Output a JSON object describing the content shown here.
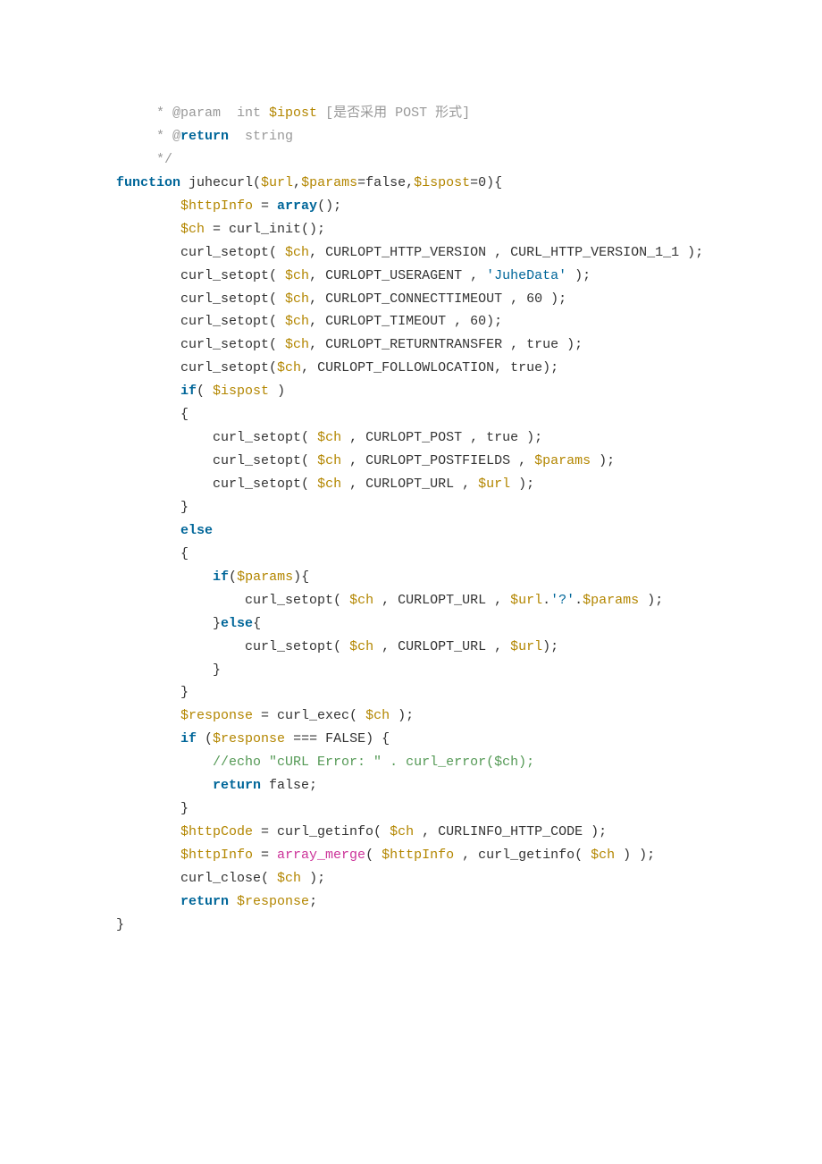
{
  "lines": [
    {
      "indent": 1,
      "segments": [
        {
          "cls": "comment",
          "t": " * @param  int "
        },
        {
          "cls": "variable",
          "t": "$ipost"
        },
        {
          "cls": "comment",
          "t": " [是否采用 POST 形式]"
        }
      ]
    },
    {
      "indent": 1,
      "segments": [
        {
          "cls": "comment",
          "t": " * @"
        },
        {
          "cls": "keyword",
          "t": "return"
        },
        {
          "cls": "comment",
          "t": "  string"
        }
      ]
    },
    {
      "indent": 1,
      "segments": [
        {
          "cls": "comment",
          "t": " */"
        }
      ]
    },
    {
      "indent": 0,
      "segments": [
        {
          "cls": "keyword",
          "t": "function"
        },
        {
          "cls": "text",
          "t": " juhecurl("
        },
        {
          "cls": "variable",
          "t": "$url"
        },
        {
          "cls": "text",
          "t": ","
        },
        {
          "cls": "variable",
          "t": "$params"
        },
        {
          "cls": "text",
          "t": "=false,"
        },
        {
          "cls": "variable",
          "t": "$ispost"
        },
        {
          "cls": "text",
          "t": "=0){"
        }
      ]
    },
    {
      "indent": 2,
      "segments": [
        {
          "cls": "variable",
          "t": "$httpInfo"
        },
        {
          "cls": "text",
          "t": " = "
        },
        {
          "cls": "keyword",
          "t": "array"
        },
        {
          "cls": "text",
          "t": "();"
        }
      ]
    },
    {
      "indent": 2,
      "segments": [
        {
          "cls": "variable",
          "t": "$ch"
        },
        {
          "cls": "text",
          "t": " = curl_init();"
        }
      ]
    },
    {
      "indent": 0,
      "segments": [
        {
          "cls": "text",
          "t": ""
        }
      ]
    },
    {
      "indent": 2,
      "segments": [
        {
          "cls": "text",
          "t": "curl_setopt( "
        },
        {
          "cls": "variable",
          "t": "$ch"
        },
        {
          "cls": "text",
          "t": ", CURLOPT_HTTP_VERSION , CURL_HTTP_VERSION_1_1 );"
        }
      ]
    },
    {
      "indent": 2,
      "segments": [
        {
          "cls": "text",
          "t": "curl_setopt( "
        },
        {
          "cls": "variable",
          "t": "$ch"
        },
        {
          "cls": "text",
          "t": ", CURLOPT_USERAGENT , "
        },
        {
          "cls": "string",
          "t": "'JuheData'"
        },
        {
          "cls": "text",
          "t": " );"
        }
      ]
    },
    {
      "indent": 2,
      "segments": [
        {
          "cls": "text",
          "t": "curl_setopt( "
        },
        {
          "cls": "variable",
          "t": "$ch"
        },
        {
          "cls": "text",
          "t": ", CURLOPT_CONNECTTIMEOUT , 60 );"
        }
      ]
    },
    {
      "indent": 2,
      "segments": [
        {
          "cls": "text",
          "t": "curl_setopt( "
        },
        {
          "cls": "variable",
          "t": "$ch"
        },
        {
          "cls": "text",
          "t": ", CURLOPT_TIMEOUT , 60);"
        }
      ]
    },
    {
      "indent": 2,
      "segments": [
        {
          "cls": "text",
          "t": "curl_setopt( "
        },
        {
          "cls": "variable",
          "t": "$ch"
        },
        {
          "cls": "text",
          "t": ", CURLOPT_RETURNTRANSFER , true );"
        }
      ]
    },
    {
      "indent": 2,
      "segments": [
        {
          "cls": "text",
          "t": "curl_setopt("
        },
        {
          "cls": "variable",
          "t": "$ch"
        },
        {
          "cls": "text",
          "t": ", CURLOPT_FOLLOWLOCATION, true);"
        }
      ]
    },
    {
      "indent": 2,
      "segments": [
        {
          "cls": "keyword",
          "t": "if"
        },
        {
          "cls": "text",
          "t": "( "
        },
        {
          "cls": "variable",
          "t": "$ispost"
        },
        {
          "cls": "text",
          "t": " )"
        }
      ]
    },
    {
      "indent": 2,
      "segments": [
        {
          "cls": "text",
          "t": "{"
        }
      ]
    },
    {
      "indent": 3,
      "segments": [
        {
          "cls": "text",
          "t": "curl_setopt( "
        },
        {
          "cls": "variable",
          "t": "$ch"
        },
        {
          "cls": "text",
          "t": " , CURLOPT_POST , true );"
        }
      ]
    },
    {
      "indent": 3,
      "segments": [
        {
          "cls": "text",
          "t": "curl_setopt( "
        },
        {
          "cls": "variable",
          "t": "$ch"
        },
        {
          "cls": "text",
          "t": " , CURLOPT_POSTFIELDS , "
        },
        {
          "cls": "variable",
          "t": "$params"
        },
        {
          "cls": "text",
          "t": " );"
        }
      ]
    },
    {
      "indent": 3,
      "segments": [
        {
          "cls": "text",
          "t": "curl_setopt( "
        },
        {
          "cls": "variable",
          "t": "$ch"
        },
        {
          "cls": "text",
          "t": " , CURLOPT_URL , "
        },
        {
          "cls": "variable",
          "t": "$url"
        },
        {
          "cls": "text",
          "t": " );"
        }
      ]
    },
    {
      "indent": 2,
      "segments": [
        {
          "cls": "text",
          "t": "}"
        }
      ]
    },
    {
      "indent": 2,
      "segments": [
        {
          "cls": "keyword",
          "t": "else"
        }
      ]
    },
    {
      "indent": 2,
      "segments": [
        {
          "cls": "text",
          "t": "{"
        }
      ]
    },
    {
      "indent": 3,
      "segments": [
        {
          "cls": "keyword",
          "t": "if"
        },
        {
          "cls": "text",
          "t": "("
        },
        {
          "cls": "variable",
          "t": "$params"
        },
        {
          "cls": "text",
          "t": "){"
        }
      ]
    },
    {
      "indent": 4,
      "segments": [
        {
          "cls": "text",
          "t": "curl_setopt( "
        },
        {
          "cls": "variable",
          "t": "$ch"
        },
        {
          "cls": "text",
          "t": " , CURLOPT_URL , "
        },
        {
          "cls": "variable",
          "t": "$url"
        },
        {
          "cls": "text",
          "t": "."
        },
        {
          "cls": "string",
          "t": "'?'"
        },
        {
          "cls": "text",
          "t": "."
        },
        {
          "cls": "variable",
          "t": "$params"
        },
        {
          "cls": "text",
          "t": " );"
        }
      ]
    },
    {
      "indent": 3,
      "segments": [
        {
          "cls": "text",
          "t": "}"
        },
        {
          "cls": "keyword",
          "t": "else"
        },
        {
          "cls": "text",
          "t": "{"
        }
      ]
    },
    {
      "indent": 4,
      "segments": [
        {
          "cls": "text",
          "t": "curl_setopt( "
        },
        {
          "cls": "variable",
          "t": "$ch"
        },
        {
          "cls": "text",
          "t": " , CURLOPT_URL , "
        },
        {
          "cls": "variable",
          "t": "$url"
        },
        {
          "cls": "text",
          "t": ");"
        }
      ]
    },
    {
      "indent": 3,
      "segments": [
        {
          "cls": "text",
          "t": "}"
        }
      ]
    },
    {
      "indent": 2,
      "segments": [
        {
          "cls": "text",
          "t": "}"
        }
      ]
    },
    {
      "indent": 2,
      "segments": [
        {
          "cls": "variable",
          "t": "$response"
        },
        {
          "cls": "text",
          "t": " = curl_exec( "
        },
        {
          "cls": "variable",
          "t": "$ch"
        },
        {
          "cls": "text",
          "t": " );"
        }
      ]
    },
    {
      "indent": 2,
      "segments": [
        {
          "cls": "keyword",
          "t": "if"
        },
        {
          "cls": "text",
          "t": " ("
        },
        {
          "cls": "variable",
          "t": "$response"
        },
        {
          "cls": "text",
          "t": " === FALSE) {"
        }
      ]
    },
    {
      "indent": 3,
      "segments": [
        {
          "cls": "comment-green",
          "t": "//echo \"cURL Error: \" . curl_error($ch);"
        }
      ]
    },
    {
      "indent": 3,
      "segments": [
        {
          "cls": "keyword",
          "t": "return"
        },
        {
          "cls": "text",
          "t": " false;"
        }
      ]
    },
    {
      "indent": 2,
      "segments": [
        {
          "cls": "text",
          "t": "}"
        }
      ]
    },
    {
      "indent": 2,
      "segments": [
        {
          "cls": "variable",
          "t": "$httpCode"
        },
        {
          "cls": "text",
          "t": " = curl_getinfo( "
        },
        {
          "cls": "variable",
          "t": "$ch"
        },
        {
          "cls": "text",
          "t": " , CURLINFO_HTTP_CODE );"
        }
      ]
    },
    {
      "indent": 2,
      "segments": [
        {
          "cls": "variable",
          "t": "$httpInfo"
        },
        {
          "cls": "text",
          "t": " = "
        },
        {
          "cls": "func",
          "t": "array_merge"
        },
        {
          "cls": "text",
          "t": "( "
        },
        {
          "cls": "variable",
          "t": "$httpInfo"
        },
        {
          "cls": "text",
          "t": " , curl_getinfo( "
        },
        {
          "cls": "variable",
          "t": "$ch"
        },
        {
          "cls": "text",
          "t": " ) );"
        }
      ]
    },
    {
      "indent": 2,
      "segments": [
        {
          "cls": "text",
          "t": "curl_close( "
        },
        {
          "cls": "variable",
          "t": "$ch"
        },
        {
          "cls": "text",
          "t": " );"
        }
      ]
    },
    {
      "indent": 2,
      "segments": [
        {
          "cls": "keyword",
          "t": "return"
        },
        {
          "cls": "text",
          "t": " "
        },
        {
          "cls": "variable",
          "t": "$response"
        },
        {
          "cls": "text",
          "t": ";"
        }
      ]
    },
    {
      "indent": 0,
      "segments": [
        {
          "cls": "text",
          "t": "}"
        }
      ]
    }
  ],
  "indentUnit": "    "
}
